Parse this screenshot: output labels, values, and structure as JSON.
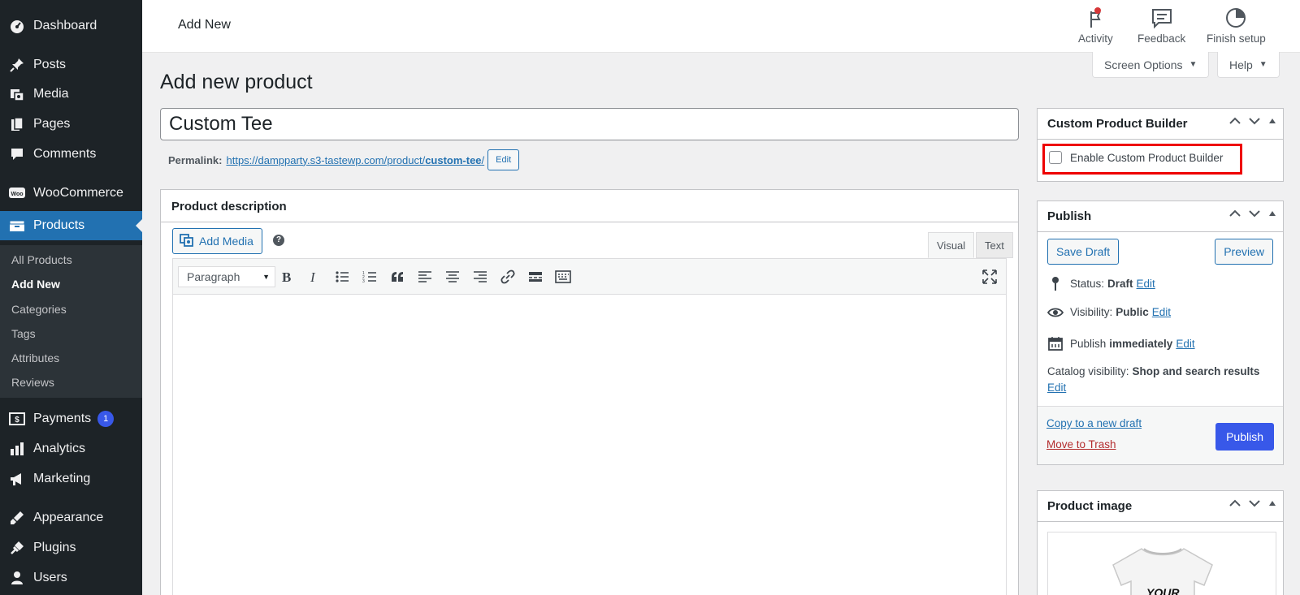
{
  "sidebar": {
    "items": [
      {
        "label": "Dashboard"
      },
      {
        "label": "Posts"
      },
      {
        "label": "Media"
      },
      {
        "label": "Pages"
      },
      {
        "label": "Comments"
      },
      {
        "label": "WooCommerce"
      },
      {
        "label": "Products"
      },
      {
        "label": "Payments",
        "badge": "1"
      },
      {
        "label": "Analytics"
      },
      {
        "label": "Marketing"
      },
      {
        "label": "Appearance"
      },
      {
        "label": "Plugins"
      },
      {
        "label": "Users"
      }
    ],
    "submenu": [
      "All Products",
      "Add New",
      "Categories",
      "Tags",
      "Attributes",
      "Reviews"
    ]
  },
  "header": {
    "page_name": "Add New",
    "actions": [
      "Activity",
      "Feedback",
      "Finish setup"
    ],
    "screen_options": "Screen Options",
    "help": "Help"
  },
  "main": {
    "title": "Add new product",
    "product_title": "Custom Tee",
    "permalink_label": "Permalink:",
    "permalink_base": "https://dampparty.s3-tastewp.com/product/",
    "permalink_slug": "custom-tee",
    "permalink_trailing": "/",
    "permalink_edit": "Edit",
    "description": {
      "heading": "Product description",
      "add_media": "Add Media",
      "help": "?",
      "tab_visual": "Visual",
      "tab_text": "Text",
      "format_select": "Paragraph"
    }
  },
  "custom_builder": {
    "heading": "Custom Product Builder",
    "checkbox_label": "Enable Custom Product Builder"
  },
  "publish": {
    "heading": "Publish",
    "save_draft": "Save Draft",
    "preview": "Preview",
    "status_label": "Status:",
    "status_value": "Draft",
    "visibility_label": "Visibility:",
    "visibility_value": "Public",
    "publish_label": "Publish",
    "publish_value": "immediately",
    "catalog_label": "Catalog visibility:",
    "catalog_value": "Shop and search results",
    "edit": "Edit",
    "copy_draft": "Copy to a new draft",
    "trash": "Move to Trash",
    "publish_button": "Publish"
  },
  "product_image": {
    "heading": "Product image",
    "shirt_text": "YOUR"
  },
  "colors": {
    "sidebar_bg": "#1d2327",
    "active": "#2271b1",
    "accent": "#3858e9",
    "highlight": "#e00000"
  }
}
